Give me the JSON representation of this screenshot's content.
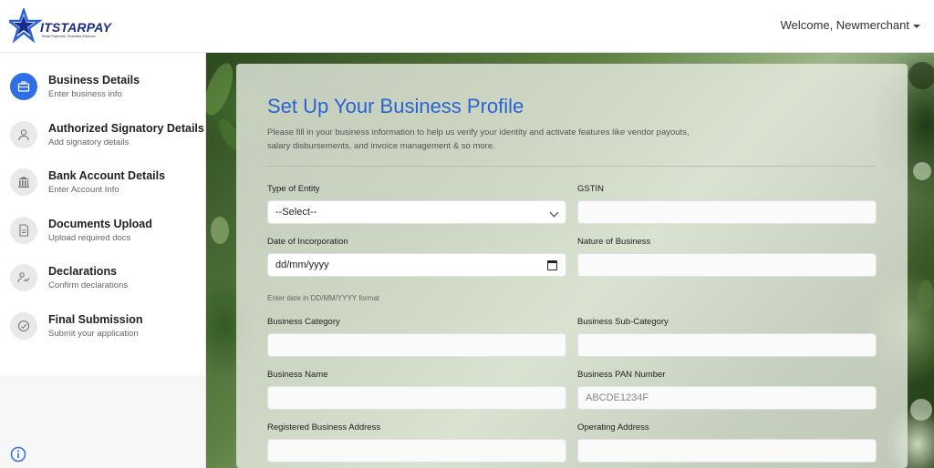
{
  "header": {
    "logo_text": "ITSTARPAY",
    "logo_tagline": "Smart Payments, Seamless Solutions",
    "welcome": "Welcome, Newmerchant"
  },
  "sidebar": {
    "steps": [
      {
        "title": "Business Details",
        "subtitle": "Enter business info",
        "icon": "briefcase-icon"
      },
      {
        "title": "Authorized Signatory Details",
        "subtitle": "Add signatory details",
        "icon": "user-icon"
      },
      {
        "title": "Bank Account Details",
        "subtitle": "Enter Account Info",
        "icon": "bank-icon"
      },
      {
        "title": "Documents Upload",
        "subtitle": "Upload required docs",
        "icon": "document-icon"
      },
      {
        "title": "Declarations",
        "subtitle": "Confirm declarations",
        "icon": "signature-icon"
      },
      {
        "title": "Final Submission",
        "subtitle": "Submit your application",
        "icon": "submit-icon"
      }
    ],
    "active_color": "#2f6fe4"
  },
  "form": {
    "title": "Set Up Your Business Profile",
    "description": "Please fill in your business information to help us verify your identity and activate features like vendor payouts, salary disbursements, and invoice management & so more.",
    "type_of_entity": {
      "label": "Type of Entity",
      "value": "--Select--"
    },
    "gstin": {
      "label": "GSTIN",
      "value": ""
    },
    "date_of_incorporation": {
      "label": "Date of Incorporation",
      "placeholder": "dd/mm/yyyy",
      "hint": "Enter date in DD/MM/YYYY format"
    },
    "nature_of_business": {
      "label": "Nature of Business",
      "value": ""
    },
    "business_category": {
      "label": "Business Category",
      "value": ""
    },
    "business_sub_category": {
      "label": "Business Sub-Category",
      "value": ""
    },
    "business_name": {
      "label": "Business Name",
      "value": ""
    },
    "business_pan": {
      "label": "Business PAN Number",
      "placeholder": "ABCDE1234F"
    },
    "registered_address": {
      "label": "Registered Business Address",
      "value": ""
    },
    "operating_address": {
      "label": "Operating Address",
      "value": ""
    }
  },
  "colors": {
    "title_blue": "#2a63d4",
    "brand_navy": "#1a2b8f"
  }
}
